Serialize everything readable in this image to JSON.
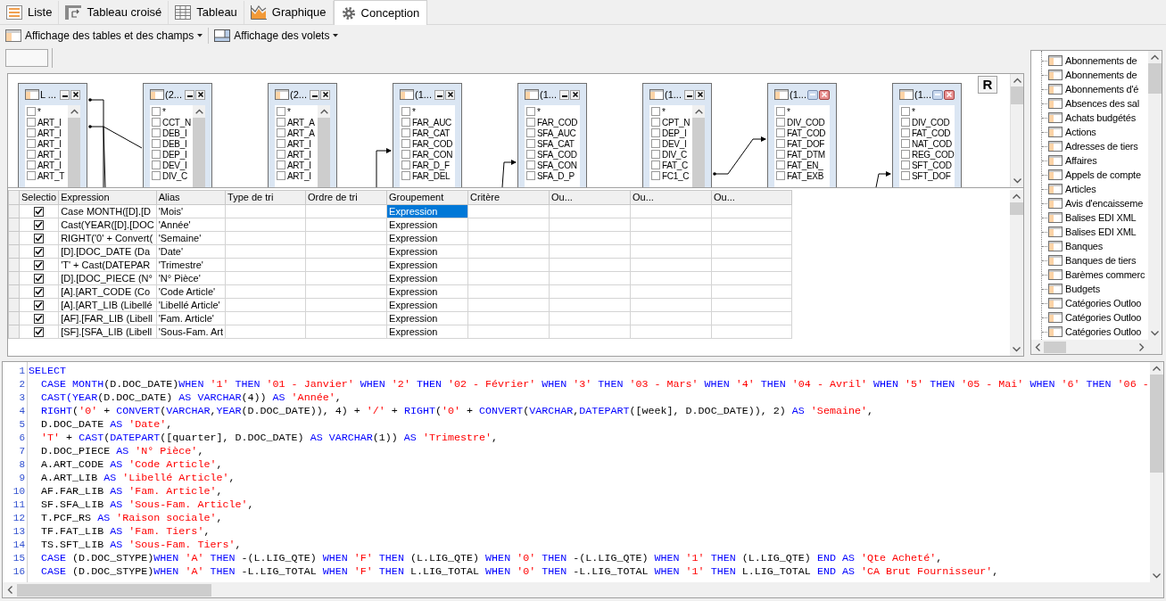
{
  "tabs": [
    {
      "label": "Liste",
      "kind": "list",
      "selected": false
    },
    {
      "label": "Tableau croisé",
      "kind": "crosstab",
      "selected": false
    },
    {
      "label": "Tableau",
      "kind": "table",
      "selected": false
    },
    {
      "label": "Graphique",
      "kind": "chart",
      "selected": false
    },
    {
      "label": "Conception",
      "kind": "design",
      "selected": true
    }
  ],
  "toolbar": [
    {
      "label": "Affichage des tables et des champs",
      "kind": "tables"
    },
    {
      "label": "Affichage des volets",
      "kind": "panes"
    }
  ],
  "diagram": {
    "button": "R",
    "tables": [
      {
        "title": "L ...",
        "scrollbar": true,
        "focused": false,
        "fields": [
          {
            "name": "*",
            "checked": false
          },
          {
            "name": "ART_I",
            "checked": false
          },
          {
            "name": "ART_I",
            "checked": false
          },
          {
            "name": "ART_I",
            "checked": false
          },
          {
            "name": "ART_I",
            "checked": false
          },
          {
            "name": "ART_I",
            "checked": false
          },
          {
            "name": "ART_T",
            "checked": false
          }
        ]
      },
      {
        "title": "(2...",
        "scrollbar": true,
        "focused": false,
        "fields": [
          {
            "name": "*",
            "checked": false
          },
          {
            "name": "CCT_N",
            "checked": false
          },
          {
            "name": "DEB_I",
            "checked": false
          },
          {
            "name": "DEB_I",
            "checked": false
          },
          {
            "name": "DEP_I",
            "checked": false
          },
          {
            "name": "DEV_I",
            "checked": false
          },
          {
            "name": "DIV_C",
            "checked": false
          }
        ]
      },
      {
        "title": "(2...",
        "scrollbar": true,
        "focused": false,
        "fields": [
          {
            "name": "*",
            "checked": false
          },
          {
            "name": "ART_A",
            "checked": false
          },
          {
            "name": "ART_A",
            "checked": false
          },
          {
            "name": "ART_I",
            "checked": false
          },
          {
            "name": "ART_I",
            "checked": false
          },
          {
            "name": "ART_I",
            "checked": false
          },
          {
            "name": "ART_I",
            "checked": false
          }
        ]
      },
      {
        "title": "(1...",
        "scrollbar": false,
        "focused": false,
        "fields": [
          {
            "name": "*",
            "checked": false
          },
          {
            "name": "FAR_AUC",
            "checked": false
          },
          {
            "name": "FAR_CAT",
            "checked": false
          },
          {
            "name": "FAR_COD",
            "checked": false
          },
          {
            "name": "FAR_CON",
            "checked": false
          },
          {
            "name": "FAR_D_F",
            "checked": false
          },
          {
            "name": "FAR_DEL",
            "checked": false
          }
        ]
      },
      {
        "title": "(1...",
        "scrollbar": false,
        "focused": false,
        "fields": [
          {
            "name": "*",
            "checked": false
          },
          {
            "name": "FAR_COD",
            "checked": false
          },
          {
            "name": "SFA_AUC",
            "checked": false
          },
          {
            "name": "SFA_CAT",
            "checked": false
          },
          {
            "name": "SFA_COD",
            "checked": false
          },
          {
            "name": "SFA_CON",
            "checked": false
          },
          {
            "name": "SFA_D_P",
            "checked": false
          }
        ]
      },
      {
        "title": "(1...",
        "scrollbar": true,
        "focused": false,
        "fields": [
          {
            "name": "*",
            "checked": false
          },
          {
            "name": "CPT_N",
            "checked": false
          },
          {
            "name": "DEP_I",
            "checked": false
          },
          {
            "name": "DEV_I",
            "checked": false
          },
          {
            "name": "DIV_C",
            "checked": false
          },
          {
            "name": "FAT_C",
            "checked": false
          },
          {
            "name": "FC1_C",
            "checked": false
          }
        ]
      },
      {
        "title": "(1...",
        "scrollbar": false,
        "focused": true,
        "fields": [
          {
            "name": "*",
            "checked": false
          },
          {
            "name": "DIV_COD",
            "checked": false
          },
          {
            "name": "FAT_COD",
            "checked": false
          },
          {
            "name": "FAT_DOF",
            "checked": false
          },
          {
            "name": "FAT_DTM",
            "checked": false
          },
          {
            "name": "FAT_EN_",
            "checked": false
          },
          {
            "name": "FAT_EXB",
            "checked": false
          }
        ]
      },
      {
        "title": "(1...",
        "scrollbar": false,
        "focused": true,
        "fields": [
          {
            "name": "*",
            "checked": false
          },
          {
            "name": "DIV_COD",
            "checked": false
          },
          {
            "name": "FAT_COD",
            "checked": false
          },
          {
            "name": "NAT_COD",
            "checked": false
          },
          {
            "name": "REG_COD",
            "checked": false
          },
          {
            "name": "SFT_COD",
            "checked": false
          },
          {
            "name": "SFT_DOF",
            "checked": false
          }
        ]
      }
    ]
  },
  "grid": {
    "columns": [
      "Selectio",
      "Expression",
      "Alias",
      "Type de tri",
      "Ordre de tri",
      "Groupement",
      "Critère",
      "Ou...",
      "Ou...",
      "Ou..."
    ],
    "rows": [
      {
        "checked": true,
        "expression": "Case MONTH([D].[D",
        "alias": "'Mois'",
        "grouping": "Expression",
        "selected": true
      },
      {
        "checked": true,
        "expression": "Cast(YEAR([D].[DOC",
        "alias": "'Année'",
        "grouping": "Expression",
        "selected": false
      },
      {
        "checked": true,
        "expression": "RIGHT('0' + Convert(",
        "alias": "'Semaine'",
        "grouping": "Expression",
        "selected": false
      },
      {
        "checked": true,
        "expression": "[D].[DOC_DATE (Da",
        "alias": "'Date'",
        "grouping": "Expression",
        "selected": false
      },
      {
        "checked": true,
        "expression": "'T' + Cast(DATEPAR",
        "alias": "'Trimestre'",
        "grouping": "Expression",
        "selected": false
      },
      {
        "checked": true,
        "expression": "[D].[DOC_PIECE (N°",
        "alias": "'N° Pièce'",
        "grouping": "Expression",
        "selected": false
      },
      {
        "checked": true,
        "expression": "[A].[ART_CODE (Co",
        "alias": "'Code Article'",
        "grouping": "Expression",
        "selected": false
      },
      {
        "checked": true,
        "expression": "[A].[ART_LIB (Libellé",
        "alias": "'Libellé Article'",
        "grouping": "Expression",
        "selected": false
      },
      {
        "checked": true,
        "expression": "[AF].[FAR_LIB (Libell",
        "alias": "'Fam. Article'",
        "grouping": "Expression",
        "selected": false
      },
      {
        "checked": true,
        "expression": "[SF].[SFA_LIB (Libell",
        "alias": "'Sous-Fam. Art",
        "grouping": "Expression",
        "selected": false
      }
    ]
  },
  "tree": {
    "items": [
      "Abonnements de",
      "Abonnements de",
      "Abonnements d'é",
      "Absences des sal",
      "Achats budgétés",
      "Actions",
      "Adresses de tiers",
      "Affaires",
      "Appels de compte",
      "Articles",
      "Avis d'encaisseme",
      "Balises EDI XML",
      "Balises EDI XML",
      "Banques",
      "Banques de tiers",
      "Barèmes commerc",
      "Budgets",
      "Catégories Outloo",
      "Catégories Outloo",
      "Catégories Outloo"
    ]
  },
  "sql": {
    "lines": [
      {
        "number": "1",
        "tokens": [
          {
            "kind": "kw",
            "text": "SELECT"
          }
        ]
      },
      {
        "number": "2",
        "tokens": [
          {
            "kind": "kw",
            "text": "  CASE MONTH"
          },
          {
            "kind": "txt",
            "text": "(D.DOC_DATE)"
          },
          {
            "kind": "kw",
            "text": "WHEN "
          },
          {
            "kind": "str",
            "text": "'1'"
          },
          {
            "kind": "kw",
            "text": " THEN "
          },
          {
            "kind": "str",
            "text": "'01 - Janvier'"
          },
          {
            "kind": "kw",
            "text": " WHEN "
          },
          {
            "kind": "str",
            "text": "'2'"
          },
          {
            "kind": "kw",
            "text": " THEN "
          },
          {
            "kind": "str",
            "text": "'02 - Février'"
          },
          {
            "kind": "kw",
            "text": " WHEN "
          },
          {
            "kind": "str",
            "text": "'3'"
          },
          {
            "kind": "kw",
            "text": " THEN "
          },
          {
            "kind": "str",
            "text": "'03 - Mars'"
          },
          {
            "kind": "kw",
            "text": " WHEN "
          },
          {
            "kind": "str",
            "text": "'4'"
          },
          {
            "kind": "kw",
            "text": " THEN "
          },
          {
            "kind": "str",
            "text": "'04 - Avril'"
          },
          {
            "kind": "kw",
            "text": " WHEN "
          },
          {
            "kind": "str",
            "text": "'5'"
          },
          {
            "kind": "kw",
            "text": " THEN "
          },
          {
            "kind": "str",
            "text": "'05 - Mai'"
          },
          {
            "kind": "kw",
            "text": " WHEN "
          },
          {
            "kind": "str",
            "text": "'6'"
          },
          {
            "kind": "kw",
            "text": " THEN "
          },
          {
            "kind": "str",
            "text": "'06 -"
          }
        ]
      },
      {
        "number": "3",
        "tokens": [
          {
            "kind": "kw",
            "text": "  CAST(YEAR"
          },
          {
            "kind": "txt",
            "text": "(D.DOC_DATE) "
          },
          {
            "kind": "kw",
            "text": "AS VARCHAR"
          },
          {
            "kind": "txt",
            "text": "(4)) "
          },
          {
            "kind": "kw",
            "text": "AS "
          },
          {
            "kind": "str",
            "text": "'Année'"
          },
          {
            "kind": "txt",
            "text": ","
          }
        ]
      },
      {
        "number": "4",
        "tokens": [
          {
            "kind": "kw",
            "text": "  RIGHT"
          },
          {
            "kind": "txt",
            "text": "("
          },
          {
            "kind": "str",
            "text": "'0'"
          },
          {
            "kind": "txt",
            "text": " + "
          },
          {
            "kind": "kw",
            "text": "CONVERT"
          },
          {
            "kind": "txt",
            "text": "("
          },
          {
            "kind": "kw",
            "text": "VARCHAR"
          },
          {
            "kind": "txt",
            "text": ","
          },
          {
            "kind": "kw",
            "text": "YEAR"
          },
          {
            "kind": "txt",
            "text": "(D.DOC_DATE)), 4) + "
          },
          {
            "kind": "str",
            "text": "'/'"
          },
          {
            "kind": "txt",
            "text": " + "
          },
          {
            "kind": "kw",
            "text": "RIGHT"
          },
          {
            "kind": "txt",
            "text": "("
          },
          {
            "kind": "str",
            "text": "'0'"
          },
          {
            "kind": "txt",
            "text": " + "
          },
          {
            "kind": "kw",
            "text": "CONVERT"
          },
          {
            "kind": "txt",
            "text": "("
          },
          {
            "kind": "kw",
            "text": "VARCHAR"
          },
          {
            "kind": "txt",
            "text": ","
          },
          {
            "kind": "kw",
            "text": "DATEPART"
          },
          {
            "kind": "txt",
            "text": "([week], D.DOC_DATE)), 2) "
          },
          {
            "kind": "kw",
            "text": "AS "
          },
          {
            "kind": "str",
            "text": "'Semaine'"
          },
          {
            "kind": "txt",
            "text": ","
          }
        ]
      },
      {
        "number": "5",
        "tokens": [
          {
            "kind": "txt",
            "text": "  D.DOC_DATE "
          },
          {
            "kind": "kw",
            "text": "AS "
          },
          {
            "kind": "str",
            "text": "'Date'"
          },
          {
            "kind": "txt",
            "text": ","
          }
        ]
      },
      {
        "number": "6",
        "tokens": [
          {
            "kind": "str",
            "text": "  'T'"
          },
          {
            "kind": "txt",
            "text": " + "
          },
          {
            "kind": "kw",
            "text": "CAST"
          },
          {
            "kind": "txt",
            "text": "("
          },
          {
            "kind": "kw",
            "text": "DATEPART"
          },
          {
            "kind": "txt",
            "text": "([quarter], D.DOC_DATE) "
          },
          {
            "kind": "kw",
            "text": "AS VARCHAR"
          },
          {
            "kind": "txt",
            "text": "(1)) "
          },
          {
            "kind": "kw",
            "text": "AS "
          },
          {
            "kind": "str",
            "text": "'Trimestre'"
          },
          {
            "kind": "txt",
            "text": ","
          }
        ]
      },
      {
        "number": "7",
        "tokens": [
          {
            "kind": "txt",
            "text": "  D.DOC_PIECE "
          },
          {
            "kind": "kw",
            "text": "AS "
          },
          {
            "kind": "str",
            "text": "'N° Pièce'"
          },
          {
            "kind": "txt",
            "text": ","
          }
        ]
      },
      {
        "number": "8",
        "tokens": [
          {
            "kind": "txt",
            "text": "  A.ART_CODE "
          },
          {
            "kind": "kw",
            "text": "AS "
          },
          {
            "kind": "str",
            "text": "'Code Article'"
          },
          {
            "kind": "txt",
            "text": ","
          }
        ]
      },
      {
        "number": "9",
        "tokens": [
          {
            "kind": "txt",
            "text": "  A.ART_LIB "
          },
          {
            "kind": "kw",
            "text": "AS "
          },
          {
            "kind": "str",
            "text": "'Libellé Article'"
          },
          {
            "kind": "txt",
            "text": ","
          }
        ]
      },
      {
        "number": "10",
        "tokens": [
          {
            "kind": "txt",
            "text": "  AF.FAR_LIB "
          },
          {
            "kind": "kw",
            "text": "AS "
          },
          {
            "kind": "str",
            "text": "'Fam. Article'"
          },
          {
            "kind": "txt",
            "text": ","
          }
        ]
      },
      {
        "number": "11",
        "tokens": [
          {
            "kind": "txt",
            "text": "  SF.SFA_LIB "
          },
          {
            "kind": "kw",
            "text": "AS "
          },
          {
            "kind": "str",
            "text": "'Sous-Fam. Article'"
          },
          {
            "kind": "txt",
            "text": ","
          }
        ]
      },
      {
        "number": "12",
        "tokens": [
          {
            "kind": "txt",
            "text": "  T.PCF_RS "
          },
          {
            "kind": "kw",
            "text": "AS "
          },
          {
            "kind": "str",
            "text": "'Raison sociale'"
          },
          {
            "kind": "txt",
            "text": ","
          }
        ]
      },
      {
        "number": "13",
        "tokens": [
          {
            "kind": "txt",
            "text": "  TF.FAT_LIB "
          },
          {
            "kind": "kw",
            "text": "AS "
          },
          {
            "kind": "str",
            "text": "'Fam. Tiers'"
          },
          {
            "kind": "txt",
            "text": ","
          }
        ]
      },
      {
        "number": "14",
        "tokens": [
          {
            "kind": "txt",
            "text": "  TS.SFT_LIB "
          },
          {
            "kind": "kw",
            "text": "AS "
          },
          {
            "kind": "str",
            "text": "'Sous-Fam. Tiers'"
          },
          {
            "kind": "txt",
            "text": ","
          }
        ]
      },
      {
        "number": "15",
        "tokens": [
          {
            "kind": "kw",
            "text": "  CASE "
          },
          {
            "kind": "txt",
            "text": "(D.DOC_STYPE)"
          },
          {
            "kind": "kw",
            "text": "WHEN "
          },
          {
            "kind": "str",
            "text": "'A'"
          },
          {
            "kind": "kw",
            "text": " THEN "
          },
          {
            "kind": "txt",
            "text": "-(L.LIG_QTE) "
          },
          {
            "kind": "kw",
            "text": "WHEN "
          },
          {
            "kind": "str",
            "text": "'F'"
          },
          {
            "kind": "kw",
            "text": " THEN "
          },
          {
            "kind": "txt",
            "text": "(L.LIG_QTE) "
          },
          {
            "kind": "kw",
            "text": "WHEN "
          },
          {
            "kind": "str",
            "text": "'0'"
          },
          {
            "kind": "kw",
            "text": " THEN "
          },
          {
            "kind": "txt",
            "text": "-(L.LIG_QTE) "
          },
          {
            "kind": "kw",
            "text": "WHEN "
          },
          {
            "kind": "str",
            "text": "'1'"
          },
          {
            "kind": "kw",
            "text": " THEN "
          },
          {
            "kind": "txt",
            "text": "(L.LIG_QTE) "
          },
          {
            "kind": "kw",
            "text": "END AS "
          },
          {
            "kind": "str",
            "text": "'Qte Acheté'"
          },
          {
            "kind": "txt",
            "text": ","
          }
        ]
      },
      {
        "number": "16",
        "tokens": [
          {
            "kind": "kw",
            "text": "  CASE "
          },
          {
            "kind": "txt",
            "text": "(D.DOC_STYPE)"
          },
          {
            "kind": "kw",
            "text": "WHEN "
          },
          {
            "kind": "str",
            "text": "'A'"
          },
          {
            "kind": "kw",
            "text": " THEN "
          },
          {
            "kind": "txt",
            "text": "-L.LIG_TOTAL "
          },
          {
            "kind": "kw",
            "text": "WHEN "
          },
          {
            "kind": "str",
            "text": "'F'"
          },
          {
            "kind": "kw",
            "text": " THEN "
          },
          {
            "kind": "txt",
            "text": "L.LIG_TOTAL "
          },
          {
            "kind": "kw",
            "text": "WHEN "
          },
          {
            "kind": "str",
            "text": "'0'"
          },
          {
            "kind": "kw",
            "text": " THEN "
          },
          {
            "kind": "txt",
            "text": "-L.LIG_TOTAL "
          },
          {
            "kind": "kw",
            "text": "WHEN "
          },
          {
            "kind": "str",
            "text": "'1'"
          },
          {
            "kind": "kw",
            "text": " THEN "
          },
          {
            "kind": "txt",
            "text": "L.LIG_TOTAL "
          },
          {
            "kind": "kw",
            "text": "END AS "
          },
          {
            "kind": "str",
            "text": "'CA Brut Fournisseur'"
          },
          {
            "kind": "txt",
            "text": ","
          }
        ]
      }
    ]
  }
}
